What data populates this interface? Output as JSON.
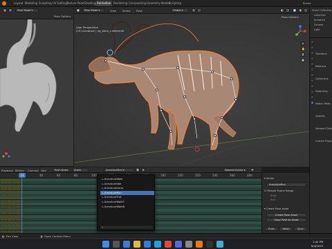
{
  "menu": {
    "items": [
      "Layout",
      "Modeling",
      "Sculpting",
      "UV Editing",
      "Texture Paint",
      "Shading",
      "Animation",
      "Rendering",
      "Compositing",
      "Geometry Nodes",
      "Scripting"
    ],
    "active_index": 6,
    "scene_label": "Scene"
  },
  "left_header": {
    "mode": "Pose Mode",
    "options_label": "Pose Options"
  },
  "main_header": {
    "mode": "Pose Mode",
    "menus": [
      "View",
      "Select",
      "Pose"
    ],
    "orientation": "Global",
    "options_label": "Pose Options"
  },
  "viewport": {
    "perspective_label": "User Perspective",
    "object_label": "(23) Armature | rig_bone_L.deformer"
  },
  "timeline": {
    "header_items": [
      "Playback",
      "Marker",
      "Channel",
      "Key",
      "Push Down",
      "Stash"
    ],
    "action_name": "ArmatureRun",
    "nearest_frame_label": "Nearest Frame",
    "ruler": [
      "20",
      "40",
      "60",
      "80",
      "100",
      "120",
      "140",
      "160",
      "180",
      "200",
      "220",
      "240",
      "260",
      "280"
    ],
    "current_frame": "23",
    "track_rows": 18
  },
  "dropdown": {
    "items": [
      "ArmatureWalk",
      "ArmatureIdle",
      "ArmatureJump",
      "ArmatureRun",
      "ArmatureTrot",
      "ArmatureWalkF",
      "ArmatureWalkB"
    ],
    "selected_index": 3,
    "search_placeholder": ""
  },
  "action_panel": {
    "section_title": "Action",
    "action_value": "ArmatureRun",
    "manual_frame_range": "Manual Frame Range",
    "start_label": "Start",
    "end_label": "End",
    "create_pose_title": "Create Pose Asset",
    "create_button": "Create Pose Asset",
    "copy_button": "Copy Pose as Asset",
    "footer": [
      "Push",
      "Stash",
      "Sync"
    ]
  },
  "outliner": {
    "items": [
      "Scene Collection",
      "Collection",
      "Armature",
      "Camera",
      "Light"
    ],
    "props": [
      "Transform",
      "Relations",
      "Collections",
      "Instancing",
      "Motion Paths",
      "Visibility",
      "Viewport Display",
      "Custom Props"
    ]
  },
  "status": {
    "left": "Pan View",
    "mid": "Open Context Menu"
  },
  "taskbar": {
    "icons": [
      "windows",
      "search",
      "widgets",
      "files",
      "browser",
      "edge",
      "chrome",
      "store",
      "settings",
      "blender",
      "terminal",
      "photos"
    ],
    "time": "1:42 PM",
    "date": "6/4/2023"
  },
  "colors": {
    "accent": "#4772b3",
    "outline": "#e8813a",
    "keyframe": "#e8c250",
    "track": "#2f4e44"
  }
}
